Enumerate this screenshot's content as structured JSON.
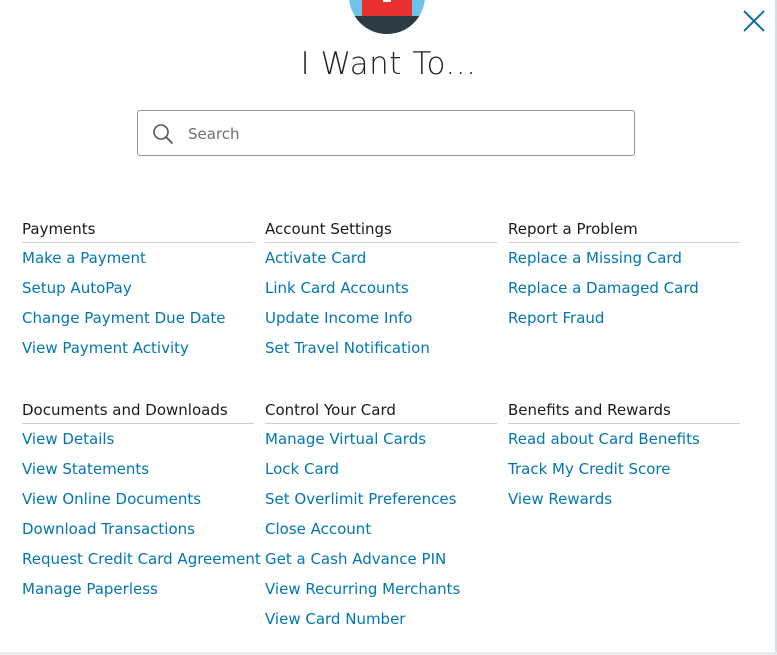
{
  "header": {
    "title": "I Want To...",
    "close_icon": "close-icon",
    "illustration_icon": "credit-card-illustration"
  },
  "search": {
    "placeholder": "Search",
    "value": "",
    "icon": "search-icon"
  },
  "colors": {
    "link": "#0276b1",
    "heading": "#1a1a1a",
    "divider": "#c9ced2",
    "close": "#0b6fa4",
    "card_red": "#e8312f",
    "sky_blue": "#6fc3ea"
  },
  "sections": {
    "payments": {
      "heading": "Payments",
      "links": [
        "Make a Payment",
        "Setup AutoPay",
        "Change Payment Due Date",
        "View Payment Activity"
      ]
    },
    "account_settings": {
      "heading": "Account Settings",
      "links": [
        "Activate Card",
        "Link Card Accounts",
        "Update Income Info",
        "Set Travel Notification"
      ]
    },
    "report_problem": {
      "heading": "Report a Problem",
      "links": [
        "Replace a Missing Card",
        "Replace a Damaged Card",
        "Report Fraud"
      ]
    },
    "documents": {
      "heading": "Documents and Downloads",
      "links": [
        "View Details",
        "View Statements",
        "View Online Documents",
        "Download Transactions",
        "Request Credit Card Agreement",
        "Manage Paperless"
      ]
    },
    "control_card": {
      "heading": "Control Your Card",
      "links": [
        "Manage Virtual Cards",
        "Lock Card",
        "Set Overlimit Preferences",
        "Close Account",
        "Get a Cash Advance PIN",
        "View Recurring Merchants",
        "View Card Number"
      ]
    },
    "benefits": {
      "heading": "Benefits and Rewards",
      "links": [
        "Read about Card Benefits",
        "Track My Credit Score",
        "View Rewards"
      ]
    }
  }
}
